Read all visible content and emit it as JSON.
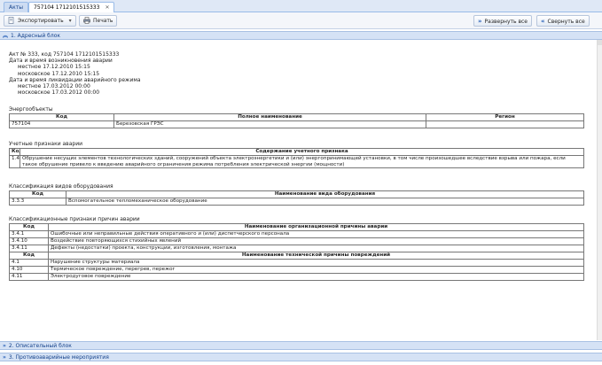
{
  "tabs": [
    {
      "label": "Акты"
    },
    {
      "label": "757104 1712101515333",
      "close": "✕"
    }
  ],
  "toolbar": {
    "export_label": "Экспортировать",
    "export_arrow": "▾",
    "print_label": "Печать",
    "expand_label": "Развернуть все",
    "collapse_label": "Свернуть все"
  },
  "panels": {
    "address": "1. Адресный блок",
    "descriptive": "2. Описательный блок",
    "measures": "3. Противоаварийные мероприятия"
  },
  "address": {
    "act": "Акт № 333, код 757104 1712101515333",
    "accident_dt_label": "Дата и время возникновения аварии",
    "accident_local": "местное 17.12.2010 15:15",
    "accident_moscow": "московское 17.12.2010 15:15",
    "liquidation_label": "Дата и время ликвидации аварийного режима",
    "liquidation_local": "местное 17.03.2012 00:00",
    "liquidation_moscow": "московское 17.03.2012 00:00"
  },
  "energy": {
    "title": "Энергообъекты",
    "headers": [
      "Код",
      "Полное наименование",
      "Регион"
    ],
    "rows": [
      [
        "757104",
        "Березовская ГРЭС",
        ""
      ]
    ]
  },
  "signs": {
    "title": "Учетные признаки аварии",
    "headers": [
      "Код",
      "Содержание учетного признака"
    ],
    "rows": [
      [
        "1.4",
        "Обрушение несущих элементов технологических зданий, сооружений объекта электроэнергетики и (или) энергопринимающей установки, в том числе произошедшее вследствие взрыва или пожара, если такое обрушение привело к введению аварийного ограничения режима потребления электрической энергии (мощности)"
      ]
    ]
  },
  "equipment": {
    "title": "Классификация видов оборудования",
    "headers": [
      "Код",
      "Наименование вида оборудования"
    ],
    "rows": [
      [
        "3.3.3",
        "Вспомогательное тепломеханическое оборудование"
      ]
    ]
  },
  "causes": {
    "title": "Классификационные признаки причин аварии",
    "org_headers": [
      "Код",
      "Наименование организационной причины аварии"
    ],
    "org_rows": [
      [
        "3.4.1",
        "Ошибочные или неправильные действия оперативного и (или) диспетчерского персонала"
      ],
      [
        "3.4.10",
        "Воздействие повторяющихся стихийных явлений"
      ],
      [
        "3.4.11",
        "Дефекты (недостатки) проекта, конструкции, изготовления, монтажа"
      ]
    ],
    "tech_headers": [
      "Код",
      "Наименование технической причины повреждений"
    ],
    "tech_rows": [
      [
        "4.1",
        "Нарушение структуры материала"
      ],
      [
        "4.10",
        "Термическое повреждение, перегрев, пережог"
      ],
      [
        "4.11",
        "Электродуговое повреждение"
      ]
    ]
  },
  "colors": {
    "accent": "#15428b",
    "panel_bg": "#d5e2f5",
    "tab_bg": "#dfe8f6"
  }
}
